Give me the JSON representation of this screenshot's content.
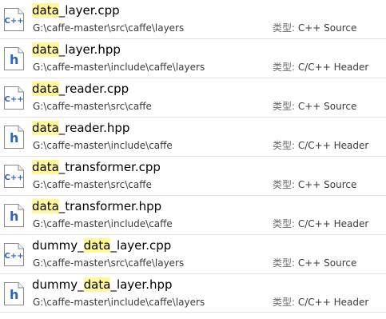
{
  "type_label": "类型:",
  "colors": {
    "highlight": "#fff799",
    "icon_blue": "#2b62c8",
    "separator": "#e3e3e3"
  },
  "results": [
    {
      "icon": "cpp-file-icon",
      "icon_text": "C++",
      "name_pre": "",
      "name_match": "data",
      "name_post": "_layer.cpp",
      "path": "G:\\caffe-master\\src\\caffe\\layers",
      "type": "C++ Source"
    },
    {
      "icon": "header-file-icon",
      "icon_text": "h",
      "name_pre": "",
      "name_match": "data",
      "name_post": "_layer.hpp",
      "path": "G:\\caffe-master\\include\\caffe\\layers",
      "type": "C/C++ Header"
    },
    {
      "icon": "cpp-file-icon",
      "icon_text": "C++",
      "name_pre": "",
      "name_match": "data",
      "name_post": "_reader.cpp",
      "path": "G:\\caffe-master\\src\\caffe",
      "type": "C++ Source"
    },
    {
      "icon": "header-file-icon",
      "icon_text": "h",
      "name_pre": "",
      "name_match": "data",
      "name_post": "_reader.hpp",
      "path": "G:\\caffe-master\\include\\caffe",
      "type": "C/C++ Header"
    },
    {
      "icon": "cpp-file-icon",
      "icon_text": "C++",
      "name_pre": "",
      "name_match": "data",
      "name_post": "_transformer.cpp",
      "path": "G:\\caffe-master\\src\\caffe",
      "type": "C++ Source"
    },
    {
      "icon": "header-file-icon",
      "icon_text": "h",
      "name_pre": "",
      "name_match": "data",
      "name_post": "_transformer.hpp",
      "path": "G:\\caffe-master\\include\\caffe",
      "type": "C/C++ Header"
    },
    {
      "icon": "cpp-file-icon",
      "icon_text": "C++",
      "name_pre": "dummy_",
      "name_match": "data",
      "name_post": "_layer.cpp",
      "path": "G:\\caffe-master\\src\\caffe\\layers",
      "type": "C++ Source"
    },
    {
      "icon": "header-file-icon",
      "icon_text": "h",
      "name_pre": "dummy_",
      "name_match": "data",
      "name_post": "_layer.hpp",
      "path": "G:\\caffe-master\\include\\caffe\\layers",
      "type": "C/C++ Header"
    }
  ]
}
